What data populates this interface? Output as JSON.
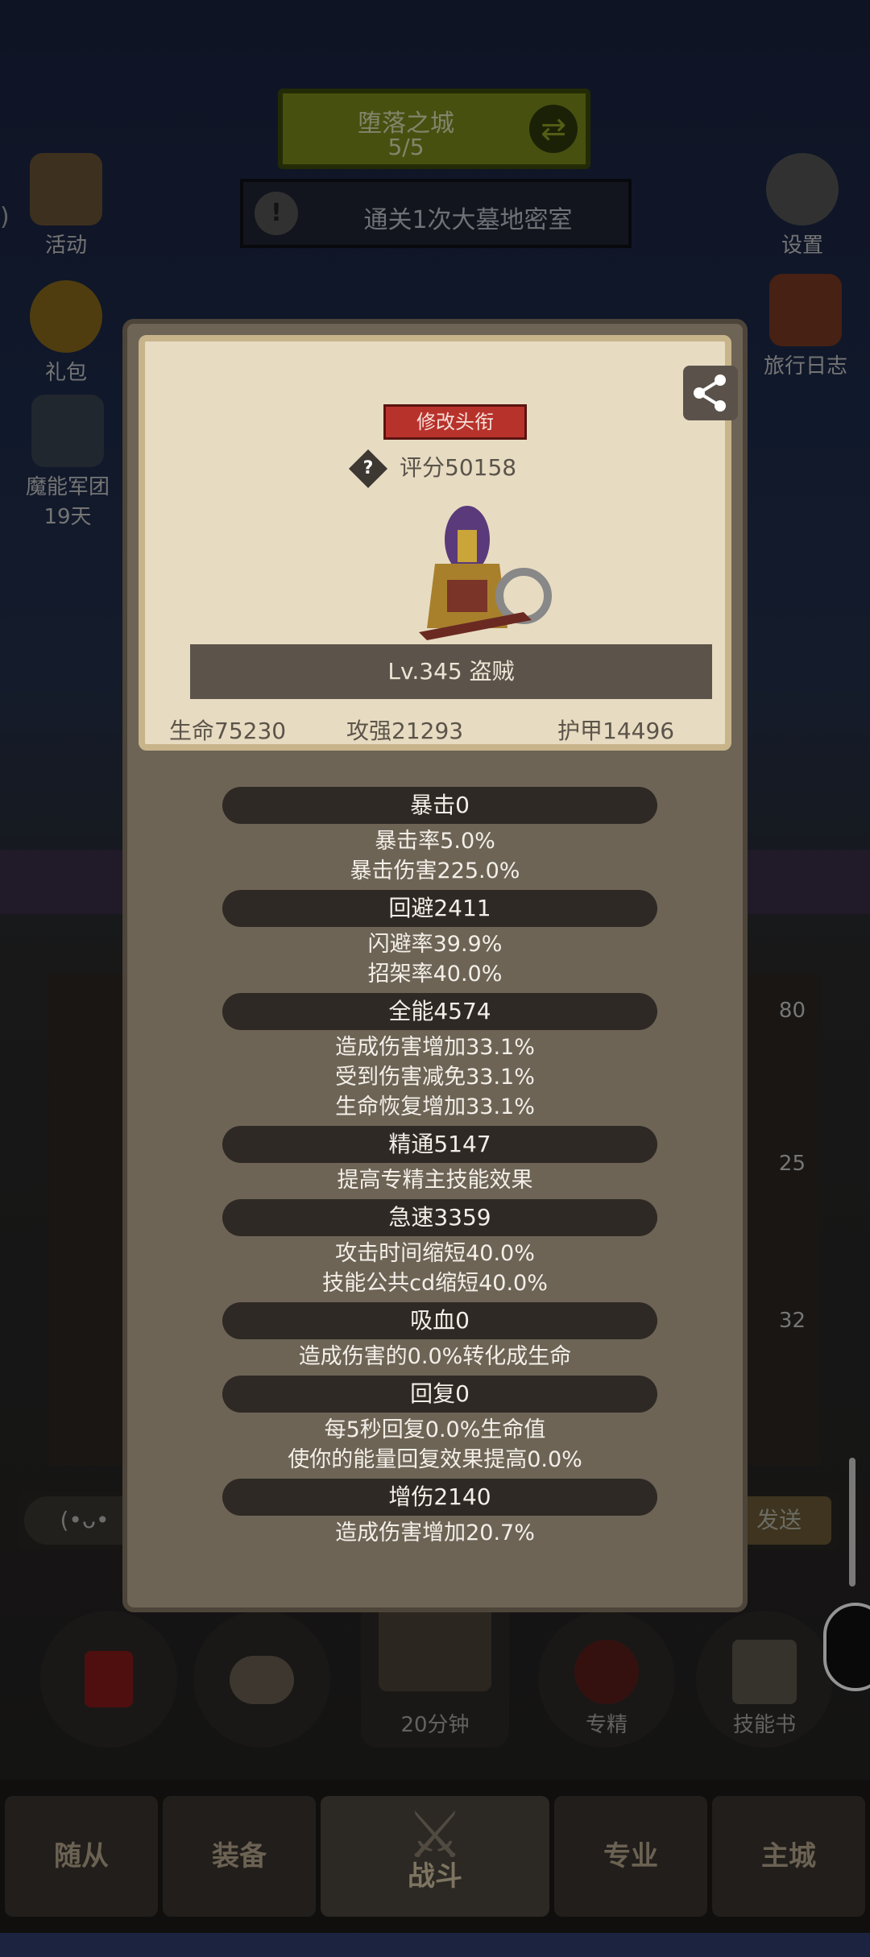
{
  "top": {
    "map_name": "堕落之城",
    "map_progress": "5/5",
    "quest_icon": "!",
    "quest_text": "通关1次大墓地密室"
  },
  "left_menu": [
    {
      "label": "活动",
      "icon": "event-scroll-icon"
    },
    {
      "label": "礼包",
      "icon": "gift-coin-icon"
    },
    {
      "label": "魔能军团",
      "sub": "19天",
      "icon": "legion-icon"
    }
  ],
  "left_edge_text": ")",
  "right_menu": [
    {
      "label": "设置",
      "icon": "gear-icon"
    },
    {
      "label": "旅行日志",
      "icon": "journal-book-icon"
    }
  ],
  "modal": {
    "title_button": "修改头衔",
    "score_help": "?",
    "score": "评分50158",
    "level_text": "Lv.345 盗贼",
    "stats": {
      "hp": "生命75230",
      "atk": "攻强21293",
      "armor": "护甲14496"
    },
    "sections": [
      {
        "header": "暴击0",
        "lines": [
          "暴击率5.0%",
          "暴击伤害225.0%"
        ]
      },
      {
        "header": "回避2411",
        "lines": [
          "闪避率39.9%",
          "招架率40.0%"
        ]
      },
      {
        "header": "全能4574",
        "lines": [
          "造成伤害增加33.1%",
          "受到伤害减免33.1%",
          "生命恢复增加33.1%"
        ]
      },
      {
        "header": "精通5147",
        "lines": [
          "提高专精主技能效果"
        ]
      },
      {
        "header": "急速3359",
        "lines": [
          "攻击时间缩短40.0%",
          "技能公共cd缩短40.0%"
        ]
      },
      {
        "header": "吸血0",
        "lines": [
          "造成伤害的0.0%转化成生命"
        ]
      },
      {
        "header": "回复0",
        "lines": [
          "每5秒回复0.0%生命值",
          "使你的能量回复效果提高0.0%"
        ]
      },
      {
        "header": "增伤2140",
        "lines": [
          "造成伤害增加20.7%"
        ]
      }
    ]
  },
  "inventory_counts": [
    "80",
    "25",
    "32"
  ],
  "chat": {
    "emoji": "(•ᴗ•",
    "send": "发送"
  },
  "bottom_actions": [
    {
      "label": "",
      "icon": "potion-icon"
    },
    {
      "label": "",
      "icon": "stone-icon"
    },
    {
      "label": "20分钟",
      "icon": "treasure-chest-icon"
    },
    {
      "label": "专精",
      "icon": "specialization-icon"
    },
    {
      "label": "技能书",
      "icon": "skill-book-icon"
    }
  ],
  "nav": [
    "随从",
    "装备",
    "战斗",
    "专业",
    "主城"
  ],
  "colors": {
    "accent_red": "#b8322c",
    "card_bg": "#e7dcc2",
    "modal_bg": "#6d6456",
    "pill_bg": "#2e2924"
  }
}
